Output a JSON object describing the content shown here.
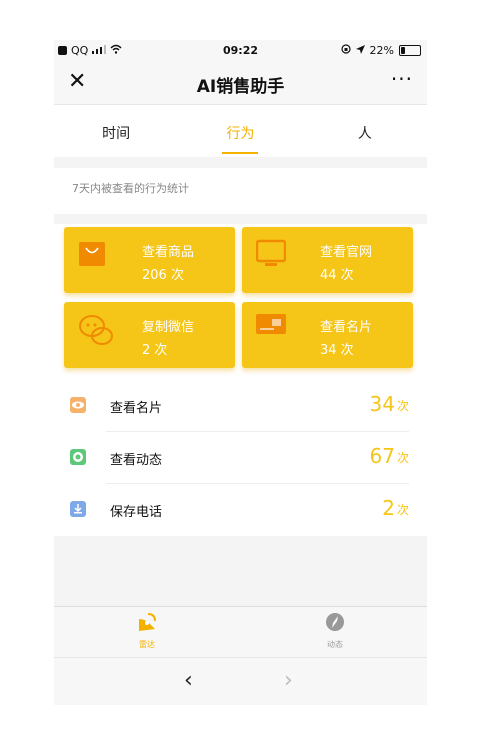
{
  "status_bar": {
    "carrier": "QQ",
    "time": "09:22",
    "battery": "22%",
    "battery_level": 0.22
  },
  "nav": {
    "title": "AI销售助手",
    "close_symbol": "✕",
    "more_symbol": "···"
  },
  "tabs": [
    {
      "label": "时间"
    },
    {
      "label": "行为"
    },
    {
      "label": "人"
    }
  ],
  "description": "7天内被查看的行为统计",
  "cards": [
    {
      "label": "查看商品",
      "count": "206 次",
      "icon": "shopping-bag-icon"
    },
    {
      "label": "查看官网",
      "count": "44 次",
      "icon": "monitor-icon"
    },
    {
      "label": "复制微信",
      "count": "2 次",
      "icon": "wechat-icon"
    },
    {
      "label": "查看名片",
      "count": "34 次",
      "icon": "card-icon"
    }
  ],
  "stats": [
    {
      "label": "查看名片",
      "value": "34",
      "unit": "次",
      "icon": "eye-icon",
      "icon_color": "#f6b26b"
    },
    {
      "label": "查看动态",
      "value": "67",
      "unit": "次",
      "icon": "aperture-icon",
      "icon_color": "#5dc77a"
    },
    {
      "label": "保存电话",
      "value": "2",
      "unit": "次",
      "icon": "download-icon",
      "icon_color": "#7ea8e6"
    }
  ],
  "tabbar": [
    {
      "label": "雷达",
      "icon": "radar-icon",
      "color": "#f5b100"
    },
    {
      "label": "动态",
      "icon": "compass-icon",
      "color": "#999999"
    }
  ],
  "browser": {
    "back": "‹",
    "forward": "›"
  },
  "colors": {
    "accent": "#f5c518",
    "tab_active": "#f5b100"
  }
}
